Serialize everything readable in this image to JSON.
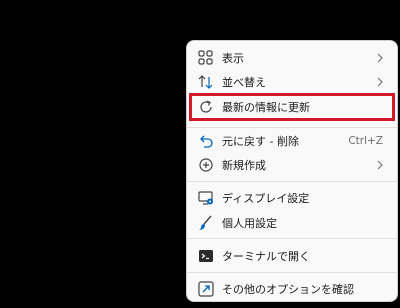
{
  "context_menu": {
    "items": [
      {
        "label": "表示",
        "icon": "view-grid-icon",
        "submenu": true
      },
      {
        "label": "並べ替え",
        "icon": "sort-icon",
        "submenu": true
      },
      {
        "label": "最新の情報に更新",
        "icon": "refresh-icon",
        "highlighted": true
      },
      {
        "label": "元に戻す - 削除",
        "icon": "undo-icon",
        "shortcut": "Ctrl+Z"
      },
      {
        "label": "新規作成",
        "icon": "new-plus-icon",
        "submenu": true
      },
      {
        "label": "ディスプレイ設定",
        "icon": "display-settings-icon"
      },
      {
        "label": "個人用設定",
        "icon": "personalize-brush-icon"
      },
      {
        "label": "ターミナルで開く",
        "icon": "terminal-icon"
      },
      {
        "label": "その他のオプションを確認",
        "icon": "more-options-icon"
      }
    ],
    "highlight_color": "#d3182a",
    "accent_color": "#0067c0"
  }
}
